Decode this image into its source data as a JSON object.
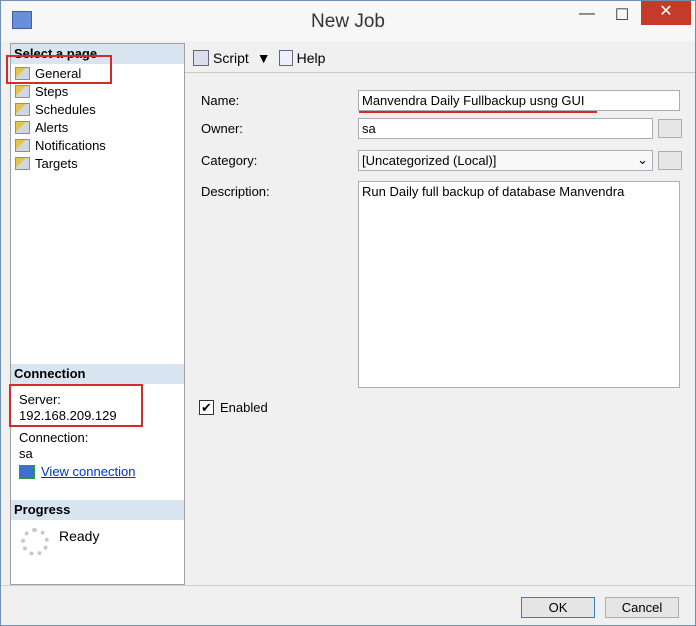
{
  "window": {
    "title": "New Job",
    "minimize": "—",
    "maximize": "☐",
    "close": "✕"
  },
  "sidebar": {
    "select_header": "Select a page",
    "items": [
      {
        "label": "General"
      },
      {
        "label": "Steps"
      },
      {
        "label": "Schedules"
      },
      {
        "label": "Alerts"
      },
      {
        "label": "Notifications"
      },
      {
        "label": "Targets"
      }
    ],
    "connection_header": "Connection",
    "server_label": "Server:",
    "server_value": "192.168.209.129",
    "connection_label": "Connection:",
    "connection_value": "sa",
    "view_connection": "View connection",
    "progress_header": "Progress",
    "progress_status": "Ready"
  },
  "toolbar": {
    "script": "Script",
    "help": "Help"
  },
  "form": {
    "name_label": "Name:",
    "name_value": "Manvendra Daily Fullbackup usng GUI",
    "owner_label": "Owner:",
    "owner_value": "sa",
    "category_label": "Category:",
    "category_value": "[Uncategorized (Local)]",
    "description_label": "Description:",
    "description_value": "Run Daily full backup of database Manvendra",
    "enabled_label": "Enabled",
    "enabled": true
  },
  "footer": {
    "ok": "OK",
    "cancel": "Cancel"
  }
}
